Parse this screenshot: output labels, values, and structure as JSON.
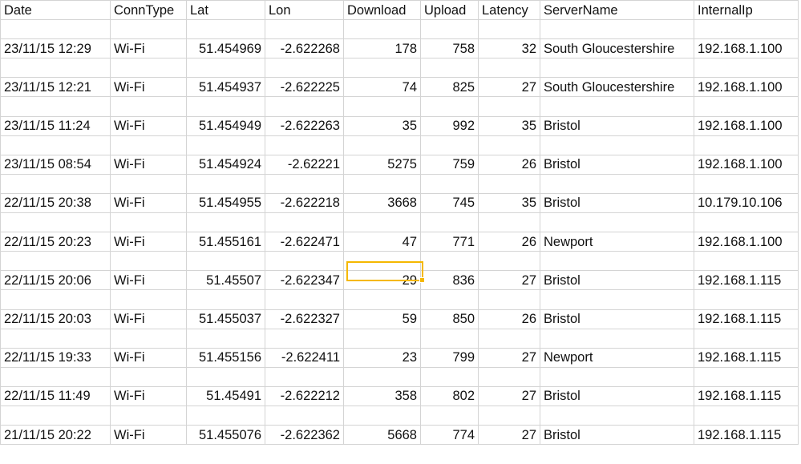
{
  "headers": [
    "Date",
    "ConnType",
    "Lat",
    "Lon",
    "Download",
    "Upload",
    "Latency",
    "ServerName",
    "InternalIp"
  ],
  "rows": [
    [
      "23/11/15 12:29",
      "Wi-Fi",
      "51.454969",
      "-2.622268",
      "178",
      "758",
      "32",
      "South Gloucestershire",
      "192.168.1.100"
    ],
    [
      "23/11/15 12:21",
      "Wi-Fi",
      "51.454937",
      "-2.622225",
      "74",
      "825",
      "27",
      "South Gloucestershire",
      "192.168.1.100"
    ],
    [
      "23/11/15 11:24",
      "Wi-Fi",
      "51.454949",
      "-2.622263",
      "35",
      "992",
      "35",
      "Bristol",
      "192.168.1.100"
    ],
    [
      "23/11/15 08:54",
      "Wi-Fi",
      "51.454924",
      "-2.62221",
      "5275",
      "759",
      "26",
      "Bristol",
      "192.168.1.100"
    ],
    [
      "22/11/15 20:38",
      "Wi-Fi",
      "51.454955",
      "-2.622218",
      "3668",
      "745",
      "35",
      "Bristol",
      "10.179.10.106"
    ],
    [
      "22/11/15 20:23",
      "Wi-Fi",
      "51.455161",
      "-2.622471",
      "47",
      "771",
      "26",
      "Newport",
      "192.168.1.100"
    ],
    [
      "22/11/15 20:06",
      "Wi-Fi",
      "51.45507",
      "-2.622347",
      "29",
      "836",
      "27",
      "Bristol",
      "192.168.1.115"
    ],
    [
      "22/11/15 20:03",
      "Wi-Fi",
      "51.455037",
      "-2.622327",
      "59",
      "850",
      "26",
      "Bristol",
      "192.168.1.115"
    ],
    [
      "22/11/15 19:33",
      "Wi-Fi",
      "51.455156",
      "-2.622411",
      "23",
      "799",
      "27",
      "Newport",
      "192.168.1.115"
    ],
    [
      "22/11/15 11:49",
      "Wi-Fi",
      "51.45491",
      "-2.622212",
      "358",
      "802",
      "27",
      "Bristol",
      "192.168.1.115"
    ],
    [
      "21/11/15 20:22",
      "Wi-Fi",
      "51.455076",
      "-2.622362",
      "5668",
      "774",
      "27",
      "Bristol",
      "192.168.1.115"
    ]
  ],
  "colors": {
    "gridline": "#d4d4d4",
    "selection": "#f5b800"
  }
}
